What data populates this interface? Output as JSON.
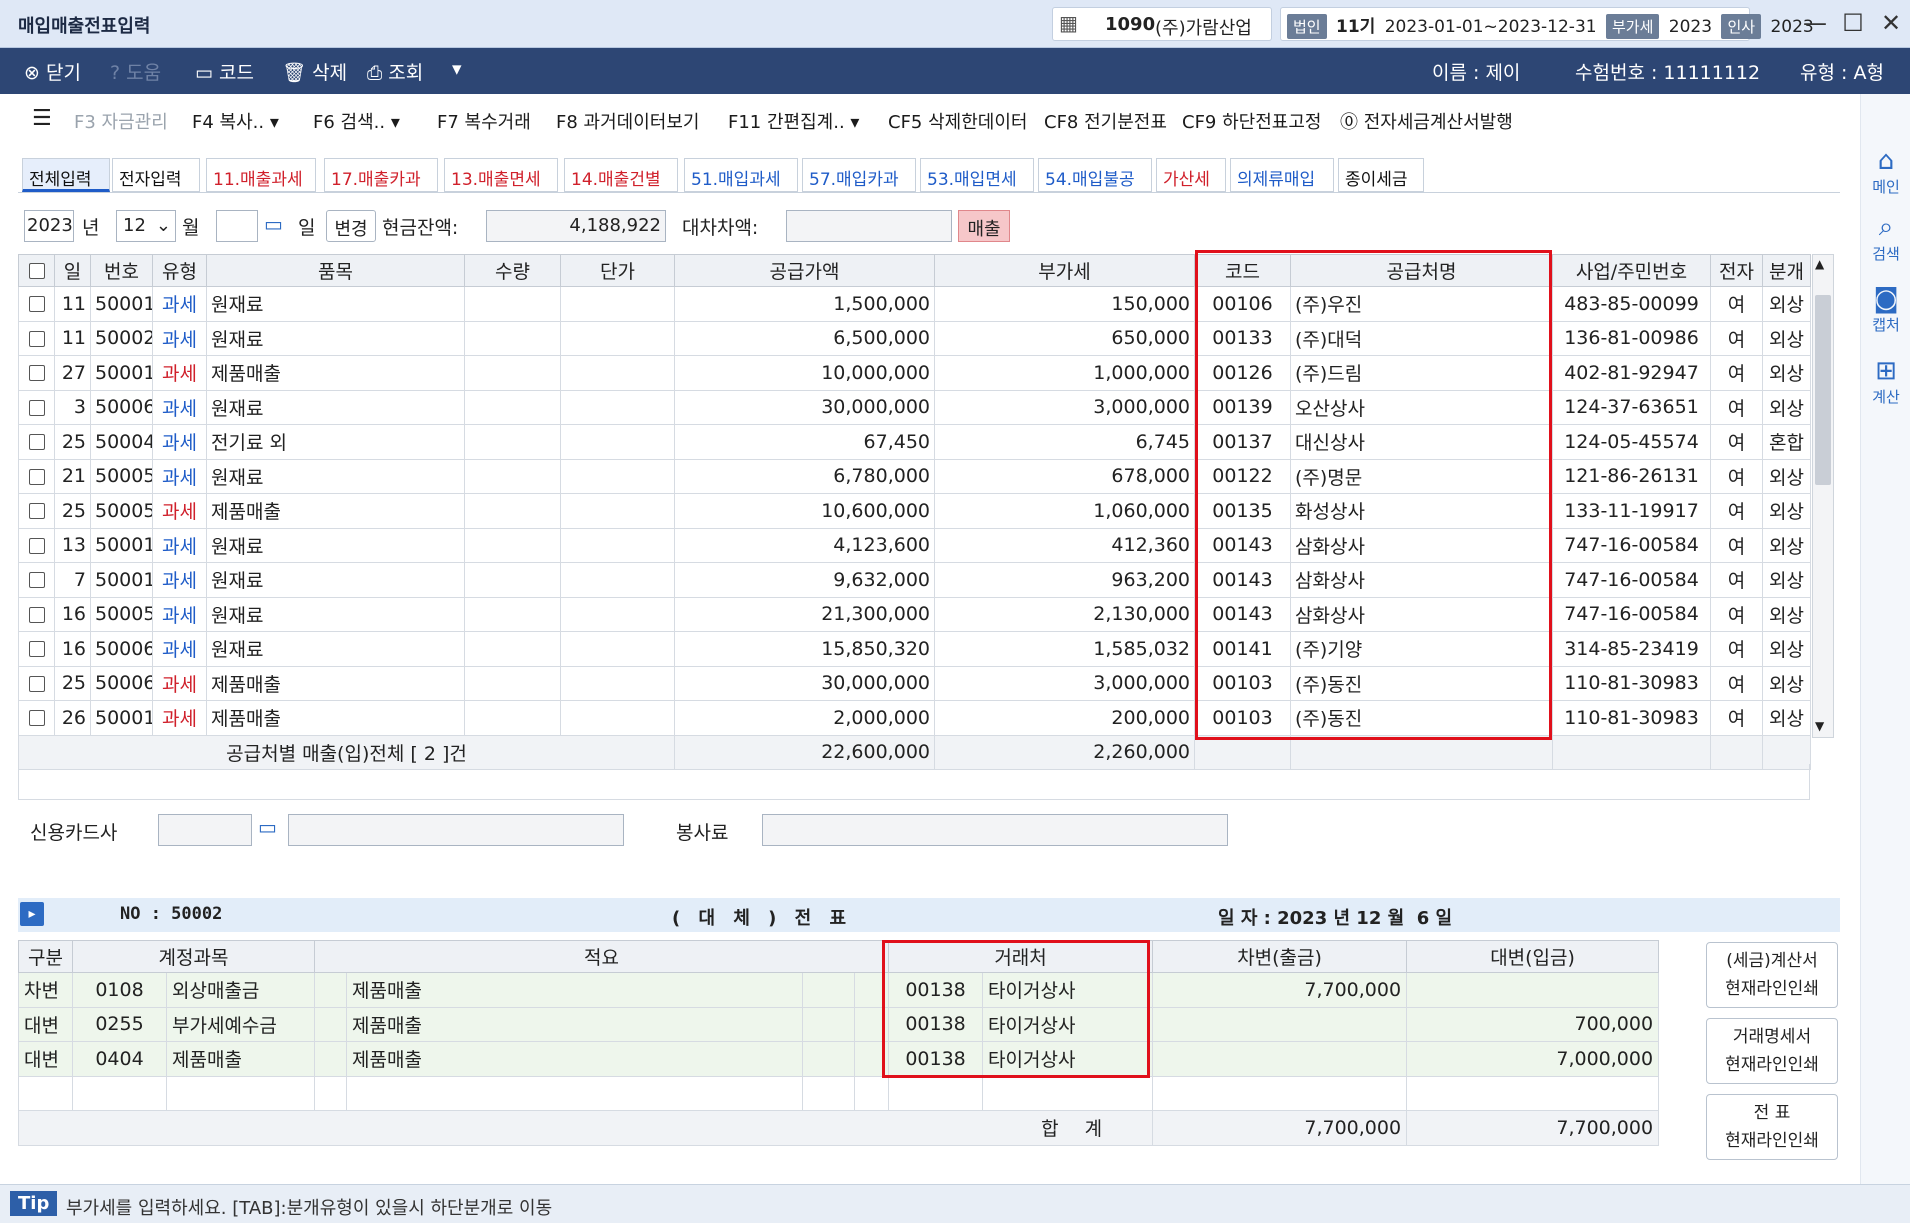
{
  "window": {
    "title": "매입매출전표입력",
    "company_code": "1090",
    "company_name": "(주)가람산업",
    "corp_badge": "법인",
    "period": "11기",
    "date_range": "2023-01-01~2023-12-31",
    "vat_badge": "부가세",
    "vat_year": "2023",
    "hr_badge": "인사",
    "hr_year": "2023"
  },
  "toolbar": {
    "close": "닫기",
    "help": "도움",
    "code": "코드",
    "delete": "삭제",
    "lookup": "조회",
    "user_label": "이름 : 제이",
    "exam_label": "수험번호 : 11111112",
    "type_label": "유형 : A형"
  },
  "fkeys": [
    {
      "label": "F3 자금관리"
    },
    {
      "label": "F4 복사.."
    },
    {
      "label": "F6 검색.."
    },
    {
      "label": "F7 복수거래"
    },
    {
      "label": "F8 과거데이터보기"
    },
    {
      "label": "F11 간편집계.."
    },
    {
      "label": "CF5 삭제한데이터"
    },
    {
      "label": "CF8 전기분전표"
    },
    {
      "label": "CF9 하단전표고정"
    },
    {
      "label": "전자세금계산서발행"
    }
  ],
  "rightbar": {
    "main": "메인",
    "search": "검색",
    "capture": "캡처",
    "calc": "계산"
  },
  "tabs": [
    "전체입력",
    "전자입력",
    "11.매출과세",
    "17.매출카과",
    "13.매출면세",
    "14.매출건별",
    "51.매입과세",
    "57.매입카과",
    "53.매입면세",
    "54.매입불공",
    "가산세",
    "의제류매입",
    "종이세금"
  ],
  "filters": {
    "year": "2023",
    "year_label": "년",
    "month": "12",
    "month_label": "월",
    "day": "",
    "day_label": "일",
    "change_btn": "변경",
    "cash_label": "현금잔액:",
    "cash_value": "4,188,922",
    "diff_label": "대차차액:",
    "diff_value": "",
    "sales_btn": "매출"
  },
  "grid": {
    "headers": [
      "일",
      "번호",
      "유형",
      "품목",
      "수량",
      "단가",
      "공급가액",
      "부가세",
      "코드",
      "공급처명",
      "사업/주민번호",
      "전자",
      "분개"
    ],
    "rows": [
      {
        "day": "11",
        "no": "50001",
        "type": "과세",
        "color": "blue",
        "item": "원재료",
        "qty": "",
        "price": "",
        "supply": "1,500,000",
        "vat": "150,000",
        "code": "00106",
        "vendor": "(주)우진",
        "biz": "483-85-00099",
        "elec": "여",
        "entry": "외상"
      },
      {
        "day": "11",
        "no": "50002",
        "type": "과세",
        "color": "blue",
        "item": "원재료",
        "qty": "",
        "price": "",
        "supply": "6,500,000",
        "vat": "650,000",
        "code": "00133",
        "vendor": "(주)대덕",
        "biz": "136-81-00986",
        "elec": "여",
        "entry": "외상"
      },
      {
        "day": "27",
        "no": "50001",
        "type": "과세",
        "color": "red",
        "item": "제품매출",
        "qty": "",
        "price": "",
        "supply": "10,000,000",
        "vat": "1,000,000",
        "code": "00126",
        "vendor": "(주)드림",
        "biz": "402-81-92947",
        "elec": "여",
        "entry": "외상"
      },
      {
        "day": "3",
        "no": "50006",
        "type": "과세",
        "color": "blue",
        "item": "원재료",
        "qty": "",
        "price": "",
        "supply": "30,000,000",
        "vat": "3,000,000",
        "code": "00139",
        "vendor": "오산상사",
        "biz": "124-37-63651",
        "elec": "여",
        "entry": "외상"
      },
      {
        "day": "25",
        "no": "50004",
        "type": "과세",
        "color": "blue",
        "item": "전기료 외",
        "qty": "",
        "price": "",
        "supply": "67,450",
        "vat": "6,745",
        "code": "00137",
        "vendor": "대신상사",
        "biz": "124-05-45574",
        "elec": "여",
        "entry": "혼합"
      },
      {
        "day": "21",
        "no": "50005",
        "type": "과세",
        "color": "blue",
        "item": "원재료",
        "qty": "",
        "price": "",
        "supply": "6,780,000",
        "vat": "678,000",
        "code": "00122",
        "vendor": "(주)명문",
        "biz": "121-86-26131",
        "elec": "여",
        "entry": "외상"
      },
      {
        "day": "25",
        "no": "50005",
        "type": "과세",
        "color": "red",
        "item": "제품매출",
        "qty": "",
        "price": "",
        "supply": "10,600,000",
        "vat": "1,060,000",
        "code": "00135",
        "vendor": "화성상사",
        "biz": "133-11-19917",
        "elec": "여",
        "entry": "외상"
      },
      {
        "day": "13",
        "no": "50001",
        "type": "과세",
        "color": "blue",
        "item": "원재료",
        "qty": "",
        "price": "",
        "supply": "4,123,600",
        "vat": "412,360",
        "code": "00143",
        "vendor": "삼화상사",
        "biz": "747-16-00584",
        "elec": "여",
        "entry": "외상"
      },
      {
        "day": "7",
        "no": "50001",
        "type": "과세",
        "color": "blue",
        "item": "원재료",
        "qty": "",
        "price": "",
        "supply": "9,632,000",
        "vat": "963,200",
        "code": "00143",
        "vendor": "삼화상사",
        "biz": "747-16-00584",
        "elec": "여",
        "entry": "외상"
      },
      {
        "day": "16",
        "no": "50005",
        "type": "과세",
        "color": "blue",
        "item": "원재료",
        "qty": "",
        "price": "",
        "supply": "21,300,000",
        "vat": "2,130,000",
        "code": "00143",
        "vendor": "삼화상사",
        "biz": "747-16-00584",
        "elec": "여",
        "entry": "외상"
      },
      {
        "day": "16",
        "no": "50006",
        "type": "과세",
        "color": "blue",
        "item": "원재료",
        "qty": "",
        "price": "",
        "supply": "15,850,320",
        "vat": "1,585,032",
        "code": "00141",
        "vendor": "(주)기양",
        "biz": "314-85-23419",
        "elec": "여",
        "entry": "외상"
      },
      {
        "day": "25",
        "no": "50006",
        "type": "과세",
        "color": "red",
        "item": "제품매출",
        "qty": "",
        "price": "",
        "supply": "30,000,000",
        "vat": "3,000,000",
        "code": "00103",
        "vendor": "(주)동진",
        "biz": "110-81-30983",
        "elec": "여",
        "entry": "외상"
      },
      {
        "day": "26",
        "no": "50001",
        "type": "과세",
        "color": "red",
        "item": "제품매출",
        "qty": "",
        "price": "",
        "supply": "2,000,000",
        "vat": "200,000",
        "code": "00103",
        "vendor": "(주)동진",
        "biz": "110-81-30983",
        "elec": "여",
        "entry": "외상"
      }
    ],
    "summary": {
      "label": "공급처별 매출(입)전체 [ 2 ]건",
      "supply": "22,600,000",
      "vat": "2,260,000"
    }
  },
  "extra": {
    "card_label": "신용카드사",
    "service_label": "봉사료"
  },
  "slip": {
    "no_label": "NO : 50002",
    "title": "( 대 체 ) 전 표",
    "date_label": "일 자 : 2023 년 12 월  6 일",
    "headers": [
      "구분",
      "계정과목",
      "적요",
      "거래처",
      "차변(출금)",
      "대변(입금)"
    ],
    "rows": [
      {
        "div": "차변",
        "acct_code": "0108",
        "acct_name": "외상매출금",
        "memo": "제품매출",
        "cust_code": "00138",
        "cust_name": "타이거상사",
        "debit": "7,700,000",
        "credit": ""
      },
      {
        "div": "대변",
        "acct_code": "0255",
        "acct_name": "부가세예수금",
        "memo": "제품매출",
        "cust_code": "00138",
        "cust_name": "타이거상사",
        "debit": "",
        "credit": "700,000"
      },
      {
        "div": "대변",
        "acct_code": "0404",
        "acct_name": "제품매출",
        "memo": "제품매출",
        "cust_code": "00138",
        "cust_name": "타이거상사",
        "debit": "",
        "credit": "7,000,000"
      }
    ],
    "total_label": "합 계",
    "total_debit": "7,700,000",
    "total_credit": "7,700,000"
  },
  "side_buttons": [
    {
      "line1": "(세금)계산서",
      "line2": "현재라인인쇄"
    },
    {
      "line1": "거래명세서",
      "line2": "현재라인인쇄"
    },
    {
      "line1": "전 표",
      "line2": "현재라인인쇄"
    }
  ],
  "tip": {
    "badge": "Tip",
    "text": "부가세를 입력하세요. [TAB]:분개유형이 있을시 하단분개로 이동"
  }
}
